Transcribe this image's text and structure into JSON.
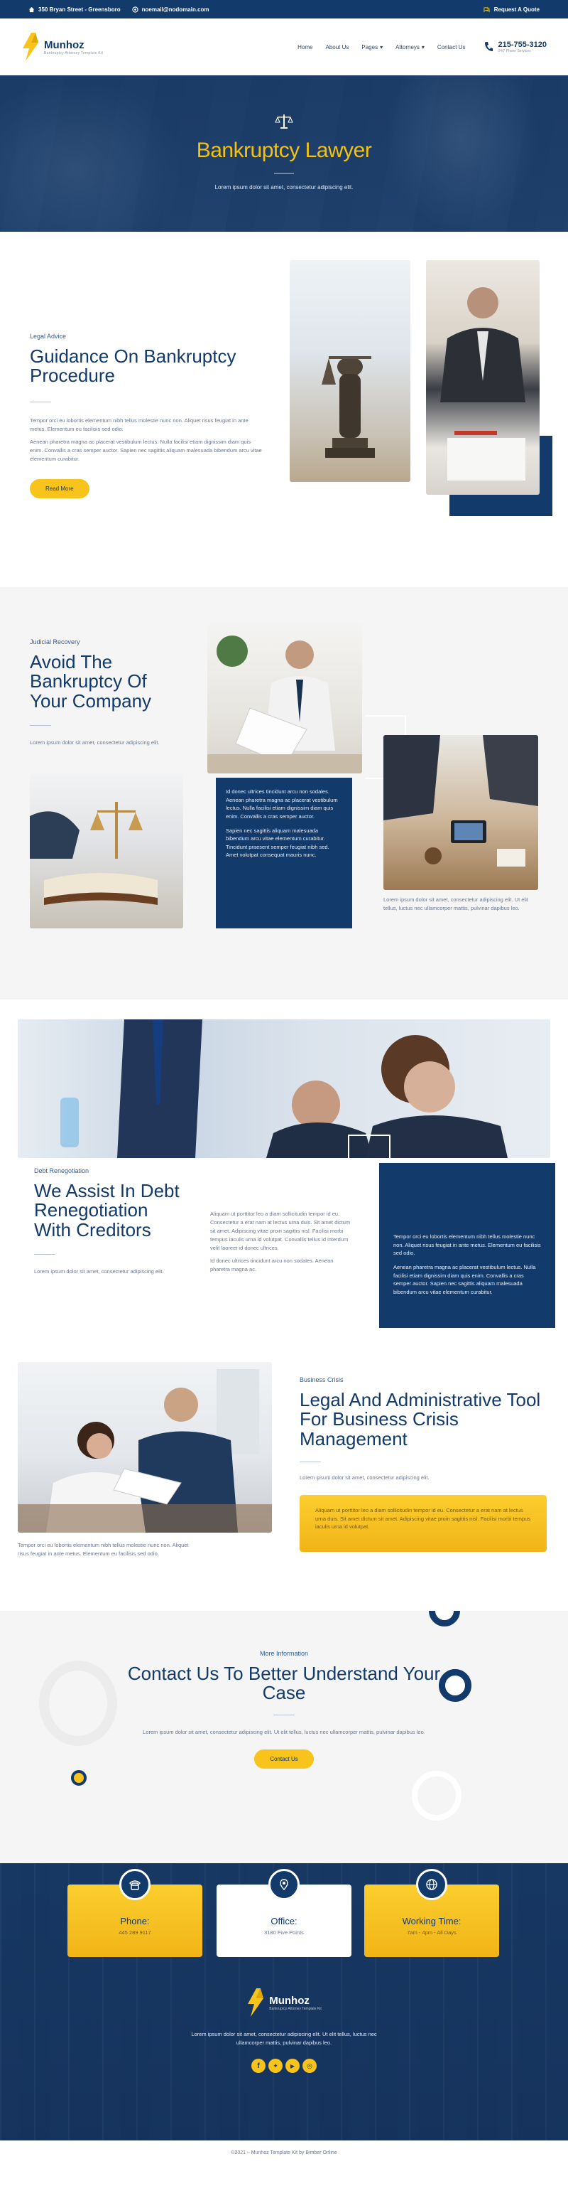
{
  "topbar": {
    "address": "350 Bryan Street - Greensboro",
    "email": "noemail@nodomain.com",
    "quote": "Request A Quote"
  },
  "header": {
    "brand": "Munhoz",
    "tagline": "Bankruptcy Attorney Template Kit",
    "nav": [
      "Home",
      "About Us",
      "Pages",
      "Attorneys",
      "Contact Us"
    ],
    "phone": "215-755-3120",
    "phone_sub": "24/7 Phone Services"
  },
  "hero": {
    "title": "Bankruptcy Lawyer",
    "subtitle": "Lorem ipsum dolor sit amet, consectetur adipiscing elit."
  },
  "guidance": {
    "eyebrow": "Legal Advice",
    "title_line1": "Guidance On Bankruptcy",
    "title_line2": "Procedure",
    "para1": "Tempor orci eu lobortis elementum nibh tellus molestie nunc non. Aliquet risus feugiat in ante metus. Elementum eu facilisis sed odio.",
    "para2": "Aenean pharetra magna ac placerat vestibulum lectus. Nulla facilisi etiam dignissim diam quis enim. Convallis a cras semper auctor. Sapien nec sagittis aliquam malesuada bibendum arcu vitae elementum curabitur.",
    "button": "Read More"
  },
  "recovery": {
    "eyebrow": "Judicial Recovery",
    "title_line1": "Avoid The",
    "title_line2": "Bankruptcy Of",
    "title_line3": "Your Company",
    "lead": "Lorem ipsum dolor sit amet, consectetur adipiscing elit.",
    "card_p1": "Id donec ultrices tincidunt arcu non sodales. Aenean pharetra magna ac placerat vestibulum lectus. Nulla facilisi etiam dignissim diam quis enim. Convallis a cras semper auctor.",
    "card_p2": "Sapien nec sagittis aliquam malesuada bibendum arcu vitae elementum curabitur. Tincidunt praesent semper feugiat nibh sed. Amet volutpat consequat mauris nunc.",
    "right_caption": "Lorem ipsum dolor sit amet, consectetur adipiscing elit. Ut elit tellus, luctus nec ullamcorper mattis, pulvinar dapibus leo."
  },
  "debt": {
    "eyebrow": "Debt Renegotiation",
    "title_line1": "We Assist In Debt",
    "title_line2": "Renegotiation",
    "title_line3": "With Creditors",
    "lead": "Lorem ipsum dolor sit amet, consectetur adipiscing elit.",
    "mid_p1": "Aliquam ut porttitor leo a diam sollicitudin tempor id eu. Consectetur a erat nam at lectus urna duis. Sit amet dictum sit amet. Adipiscing vitae proin sagittis nisl. Facilisi morbi tempus iaculis urna id volutpat. Convallis tellus id interdum velit laoreet id donec ultrices.",
    "mid_p2": "Id donec ultrices tincidunt arcu non sodales. Aenean pharetra magna ac.",
    "card_p1": "Tempor orci eu lobortis elementum nibh tellus molestie nunc non. Aliquet risus feugiat in ante metus. Elementum eu facilisis sed odio.",
    "card_p2": "Aenean pharetra magna ac placerat vestibulum lectus. Nulla facilisi etiam dignissim diam quis enim. Convallis a cras semper auctor. Sapien nec sagittis aliquam malesuada bibendum arcu vitae elementum curabitur."
  },
  "crisis": {
    "eyebrow": "Business Crisis",
    "title_line1": "Legal And Administrative Tool",
    "title_line2": "For Business Crisis",
    "title_line3": "Management",
    "lead": "Lorem ipsum dolor sit amet, consectetur adipiscing elit.",
    "box": "Aliquam ut porttitor leo a diam sollicitudin tempor id eu. Consectetur a erat nam at lectus urna duis. Sit amet dictum sit amet. Adipiscing vitae proin sagittis nisl. Facilisi morbi tempus iaculis urna id volutpat.",
    "caption": "Tempor orci eu lobortis elementum nibh tellus molestie nunc non. Aliquet risus feugiat in ante metus. Elementum eu facilisis sed odio."
  },
  "contact": {
    "eyebrow": "More Information",
    "title_line1": "Contact Us To Better Understand Your",
    "title_line2": "Case",
    "text": "Lorem ipsum dolor sit amet, consectetur adipiscing elit. Ut elit tellus, luctus nec ullamcorper mattis, pulvinar dapibus leo.",
    "button": "Contact Us"
  },
  "info": [
    {
      "label": "Phone:",
      "value": "445 289 9117"
    },
    {
      "label": "Office:",
      "value": "3180 Five Points"
    },
    {
      "label": "Working Time:",
      "value": "7am - 4pm - All Days"
    }
  ],
  "footer_block": {
    "brand": "Munhoz",
    "tagline": "Bankruptcy Attorney Template Kit",
    "text": "Lorem ipsum dolor sit amet, consectetur adipiscing elit. Ut elit tellus, luctus nec ullamcorper mattis, pulvinar dapibus leo."
  },
  "copyright": "©2021 – Munhoz Template Kit by Bimber Online",
  "colors": {
    "navy": "#123a6b",
    "yellow": "#f8c31a",
    "blue_text": "#2e5e9c"
  }
}
